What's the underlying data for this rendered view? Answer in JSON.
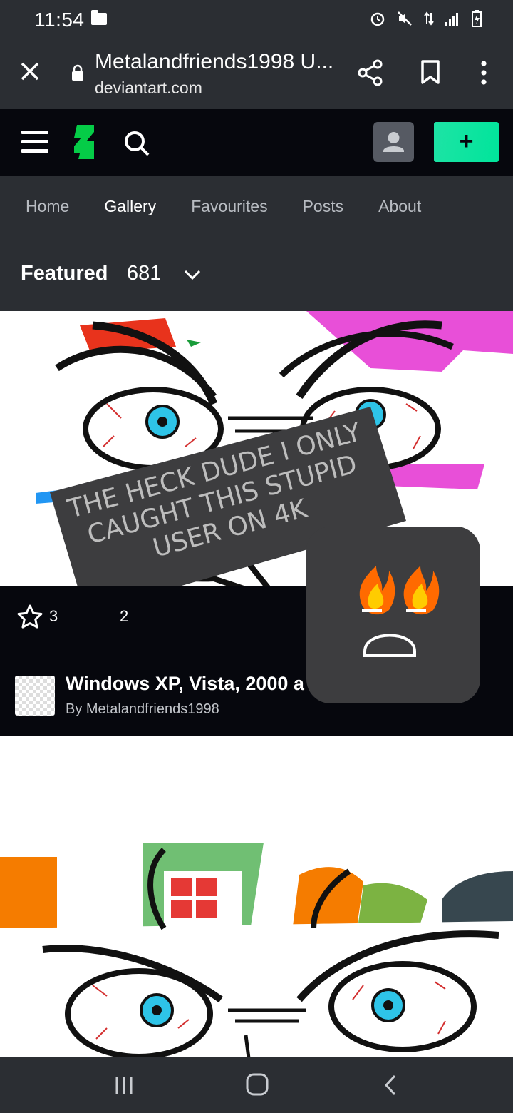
{
  "status_bar": {
    "time": "11:54"
  },
  "browser": {
    "page_title": "Metalandfriends1998 U...",
    "domain": "deviantart.com"
  },
  "tabs": [
    {
      "label": "Home"
    },
    {
      "label": "Gallery",
      "active": true
    },
    {
      "label": "Favourites"
    },
    {
      "label": "Posts"
    },
    {
      "label": "About"
    }
  ],
  "gallery": {
    "section_label": "Featured",
    "count": "681"
  },
  "deviation": {
    "favourites": "3",
    "comments": "2",
    "title": "Windows XP, Vista, 2000 a",
    "author": "By Metalandfriends1998"
  },
  "overlay": {
    "speech_text": "THE HECK DUDE I ONLY CAUGHT THIS STUPID USER ON 4K"
  },
  "colors": {
    "accent": "#00e59b",
    "bar_bg": "#2b2e33",
    "dark_bg": "#06070d"
  }
}
